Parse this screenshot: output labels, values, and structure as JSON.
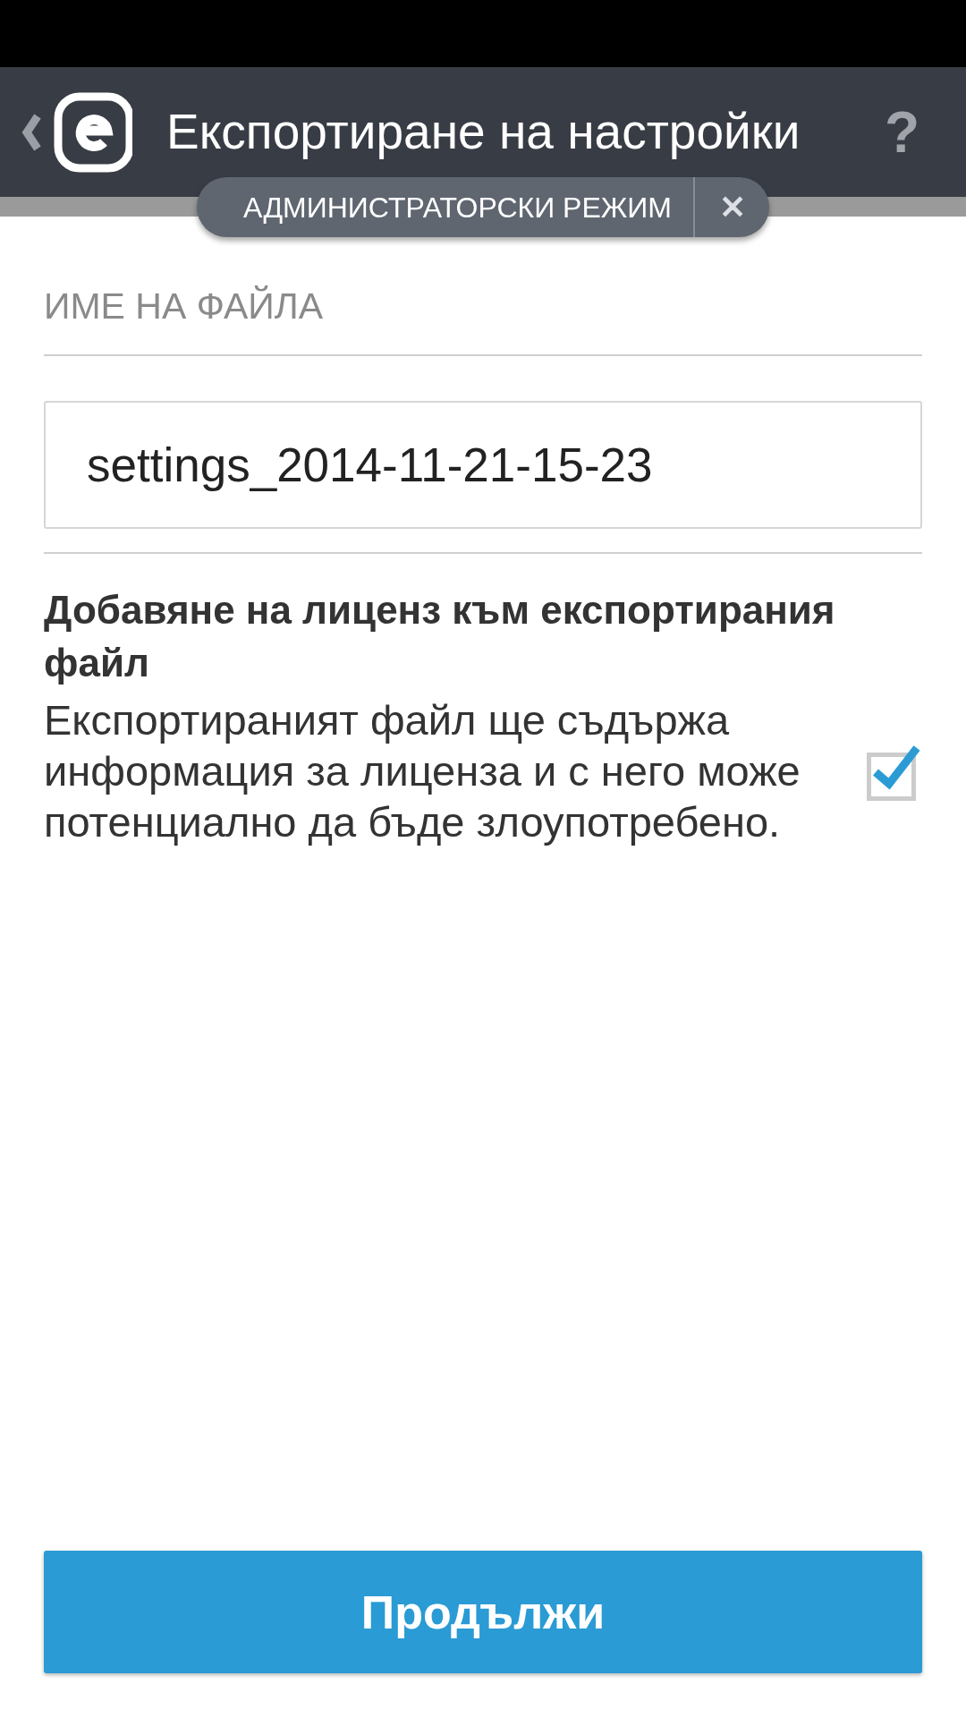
{
  "header": {
    "title": "Експортиране на настройки",
    "help": "?"
  },
  "admin_banner": {
    "label": "АДМИНИСТРАТОРСКИ РЕЖИМ",
    "close": "✕"
  },
  "filename_section": {
    "label": "ИМЕ НА ФАЙЛА",
    "value": "settings_2014-11-21-15-23"
  },
  "license_option": {
    "title": "Добавяне на лиценз към експортирания файл",
    "description": "Експортираният файл ще съдържа информация за лиценза и с него може потенциално да бъде злоупотребено.",
    "checked": true
  },
  "continue_button": {
    "label": "Продължи"
  }
}
